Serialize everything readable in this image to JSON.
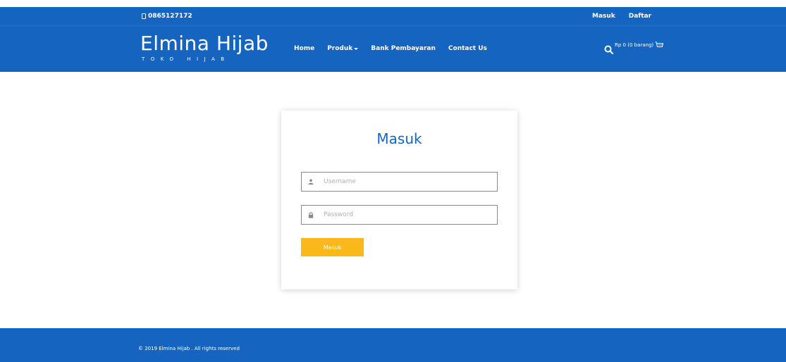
{
  "topbar": {
    "phone_icon": "phone-icon",
    "phone": "0865127172",
    "login_link": "Masuk",
    "register_link": "Daftar"
  },
  "navbar": {
    "brand_name": "Elmina Hijab",
    "brand_tagline": "TOKO HIJAB",
    "menu": {
      "home": "Home",
      "produk": "Produk",
      "bank": "Bank Pembayaran",
      "contact": "Contact Us"
    },
    "cart_text": "Rp 0 (0 barang)",
    "icons": [
      "search-icon",
      "cart-icon",
      "chevron-down-icon"
    ]
  },
  "login": {
    "title": "Masuk",
    "username_placeholder": "Username",
    "username_value": "",
    "password_placeholder": "Password",
    "password_value": "",
    "submit_label": "Masuk",
    "icons": [
      "user-icon",
      "lock-icon"
    ]
  },
  "footer": {
    "copyright": "© 2019 Elmina Hijab . All rights reserved"
  },
  "colors": {
    "primary": "#1565c0",
    "accent_button": "#fbb81b",
    "background": "#ffffff"
  }
}
